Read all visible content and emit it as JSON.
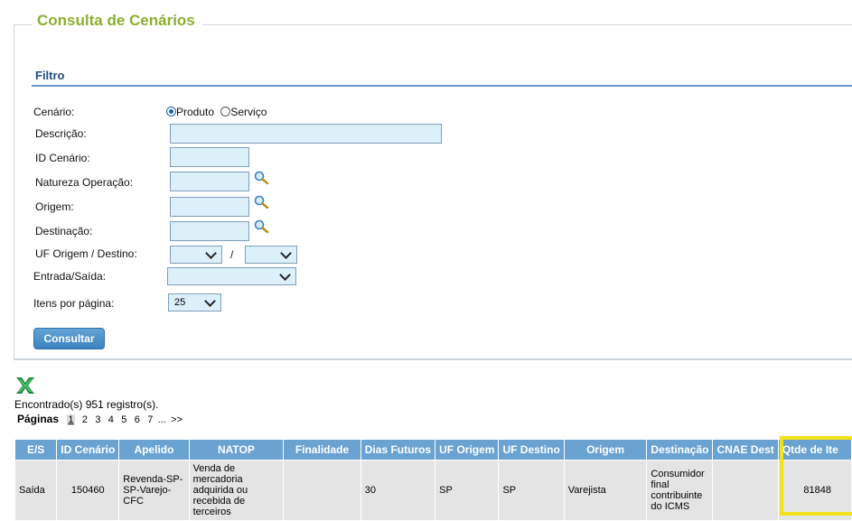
{
  "page": {
    "title": "Consulta de Cenários"
  },
  "filter": {
    "title": "Filtro",
    "cenario": {
      "label": "Cenário:",
      "options": [
        "Produto",
        "Serviço"
      ],
      "selected": "Produto"
    },
    "descricao": {
      "label": "Descrição:",
      "value": ""
    },
    "id_cenario": {
      "label": "ID Cenário:",
      "value": ""
    },
    "natureza": {
      "label": "Natureza Operação:",
      "value": ""
    },
    "origem": {
      "label": "Origem:",
      "value": ""
    },
    "destinacao": {
      "label": "Destinação:",
      "value": ""
    },
    "uf": {
      "label": "UF Origem / Destino:",
      "separator": "/",
      "origem_value": "",
      "destino_value": ""
    },
    "entrada_saida": {
      "label": "Entrada/Saída:",
      "value": ""
    },
    "itens_por_pagina": {
      "label": "Itens por página:",
      "value": "25"
    },
    "submit_label": "Consultar"
  },
  "results": {
    "count_text": "Encontrado(s) 951 registro(s).",
    "pages_label": "Páginas",
    "pages": [
      "1",
      "2",
      "3",
      "4",
      "5",
      "6",
      "7"
    ],
    "current_page": "1",
    "ellipsis": "...",
    "next": ">>",
    "columns": [
      "E/S",
      "ID Cenário",
      "Apelido",
      "NATOP",
      "Finalidade",
      "Dias Futuros",
      "UF Origem",
      "UF Destino",
      "Origem",
      "Destinação",
      "CNAE Dest",
      "Qtde de Ite"
    ],
    "rows": [
      {
        "es": "Saída",
        "id": "150460",
        "apelido": "Revenda-SP-SP-Varejo-CFC",
        "natop": "Venda de mercadoria adquirida ou recebida de terceiros",
        "finalidade": "",
        "dias": "30",
        "uf_origem": "SP",
        "uf_destino": "SP",
        "origem": "Varejista",
        "destinacao": "Consumidor final contribuinte do ICMS",
        "cnae": "",
        "qtde": "81848"
      }
    ]
  },
  "colors": {
    "accent_title": "#8ab02e",
    "header_bg": "#6aa2d1",
    "highlight": "#f3e21b",
    "input_bg": "#dcf0fa"
  },
  "icons": {
    "lookup": "magnifier-icon",
    "export": "excel-icon"
  }
}
